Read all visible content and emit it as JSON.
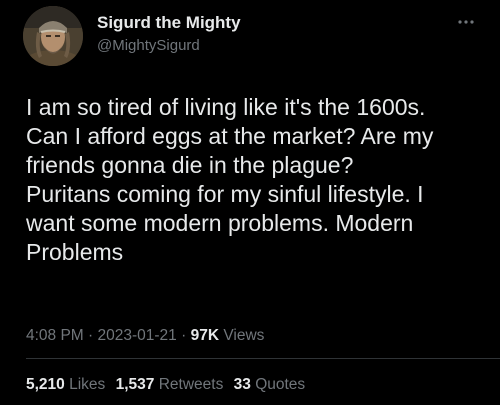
{
  "author": {
    "name": "Sigurd the Mighty",
    "handle": "@MightySigurd"
  },
  "tweet": {
    "text": "I am so tired of living like it's the 1600s.\nCan I afford eggs at the market? Are my\nfriends gonna die in the plague?\nPuritans coming for my sinful lifestyle.  I\nwant some modern problems.  Modern\nProblems"
  },
  "meta": {
    "time": "4:08 PM",
    "separator1": " · ",
    "date": "2023-01-21",
    "separator2": " · ",
    "views_count": "97K",
    "views_label": " Views"
  },
  "stats": {
    "likes_count": "5,210",
    "likes_label": " Likes",
    "retweets_count": "1,537",
    "retweets_label": " Retweets",
    "quotes_count": "33",
    "quotes_label": " Quotes"
  },
  "icons": {
    "more": "more-icon",
    "avatar": "avatar-image"
  },
  "colors": {
    "background": "#000000",
    "primary_text": "#e7e9ea",
    "secondary_text": "#71767b",
    "divider": "#2f3336"
  }
}
